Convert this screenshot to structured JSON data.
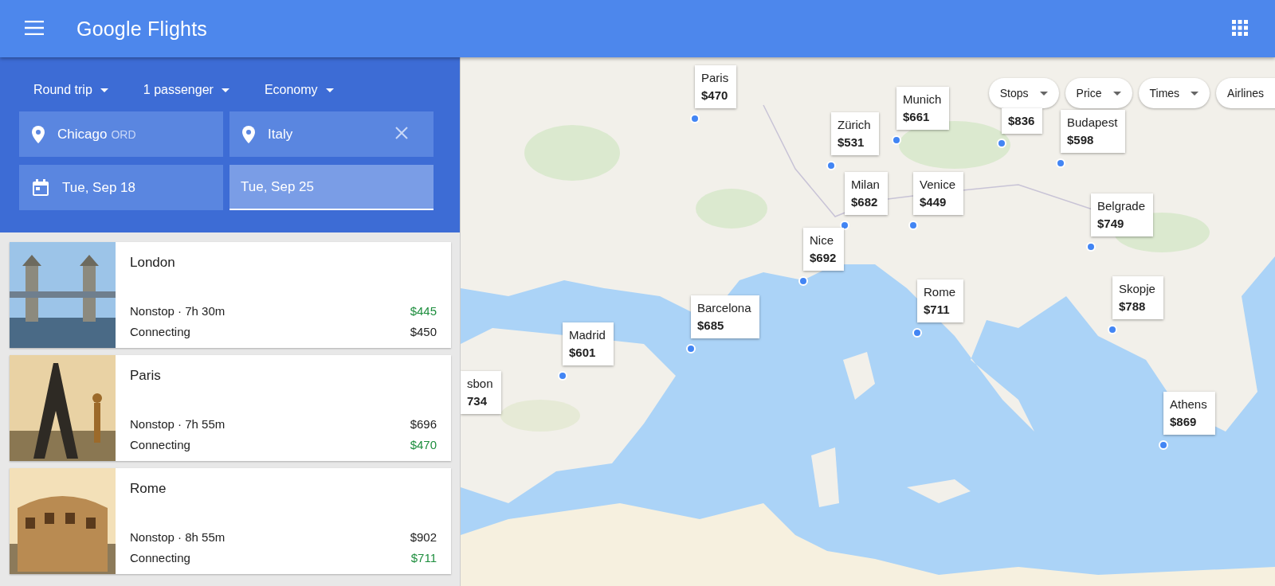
{
  "header": {
    "logo": "Google Flights"
  },
  "search": {
    "trip_type": "Round trip",
    "passengers": "1 passenger",
    "cabin": "Economy",
    "origin": {
      "city": "Chicago",
      "code": "ORD"
    },
    "destination": "Italy",
    "dates": [
      {
        "label": "Tue, Sep 18",
        "selected": false
      },
      {
        "label": "Tue, Sep 25",
        "selected": true
      }
    ]
  },
  "results": [
    {
      "city": "London",
      "options": [
        {
          "label": "Nonstop · 7h 30m",
          "price": "$445",
          "lowest": true
        },
        {
          "label": "Connecting",
          "price": "$450",
          "lowest": false
        }
      ]
    },
    {
      "city": "Paris",
      "options": [
        {
          "label": "Nonstop · 7h 55m",
          "price": "$696",
          "lowest": false
        },
        {
          "label": "Connecting",
          "price": "$470",
          "lowest": true
        }
      ]
    },
    {
      "city": "Rome",
      "options": [
        {
          "label": "Nonstop · 8h 55m",
          "price": "$902",
          "lowest": false
        },
        {
          "label": "Connecting",
          "price": "$711",
          "lowest": true
        }
      ]
    }
  ],
  "filters": [
    "Stops",
    "Price",
    "Times",
    "Airlines"
  ],
  "map": {
    "kind": "picture",
    "pins": [
      {
        "city": "Paris",
        "price": "$470"
      },
      {
        "city": "Munich",
        "price": "$661"
      },
      {
        "city": "Zürich",
        "price": "$531"
      },
      {
        "price": "$836"
      },
      {
        "city": "Budapest",
        "price": "$598"
      },
      {
        "city": "Milan",
        "price": "$682"
      },
      {
        "city": "Venice",
        "price": "$449"
      },
      {
        "city": "Belgrade",
        "price": "$749"
      },
      {
        "city": "Nice",
        "price": "$692"
      },
      {
        "city": "Rome",
        "price": "$711"
      },
      {
        "city": "Skopje",
        "price": "$788"
      },
      {
        "city": "Barcelona",
        "price": "$685"
      },
      {
        "city": "Madrid",
        "price": "$601"
      },
      {
        "city": "sbon",
        "price": "734"
      },
      {
        "city": "Athens",
        "price": "$869"
      }
    ]
  }
}
